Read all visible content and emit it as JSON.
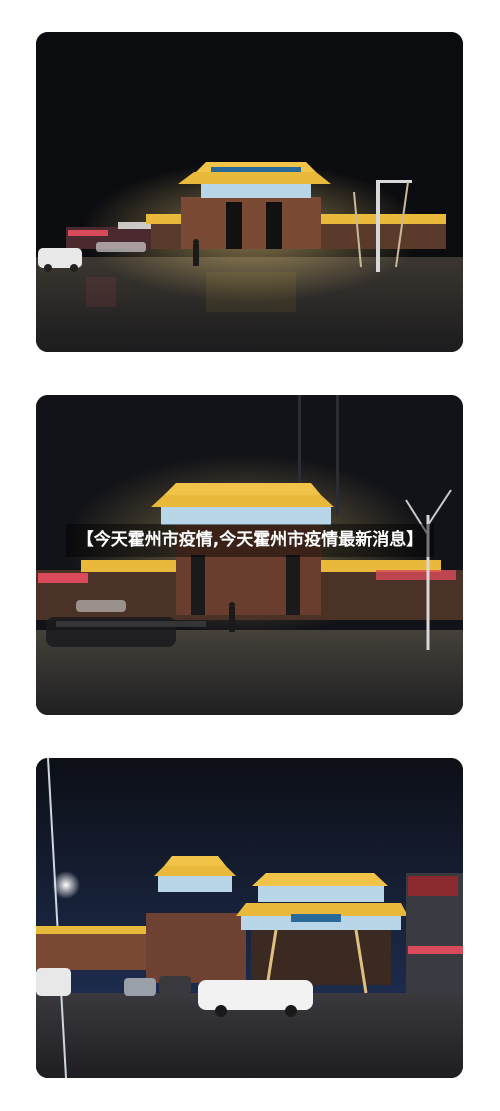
{
  "article": {
    "caption": "【今天霍州市疫情,今天霍州市疫情最新消息】"
  },
  "photos": [
    {
      "subject": "archway-night-scene-1"
    },
    {
      "subject": "archway-night-scene-2"
    },
    {
      "subject": "archway-night-scene-3"
    }
  ],
  "colors": {
    "sky": "#0b0c10",
    "road": "#2a2a2c",
    "roof_gold": "#e8b93a",
    "lights_warm": "#f3d27a",
    "neon_red": "#d94a5a",
    "sky_blue": "#1c2a4a"
  }
}
